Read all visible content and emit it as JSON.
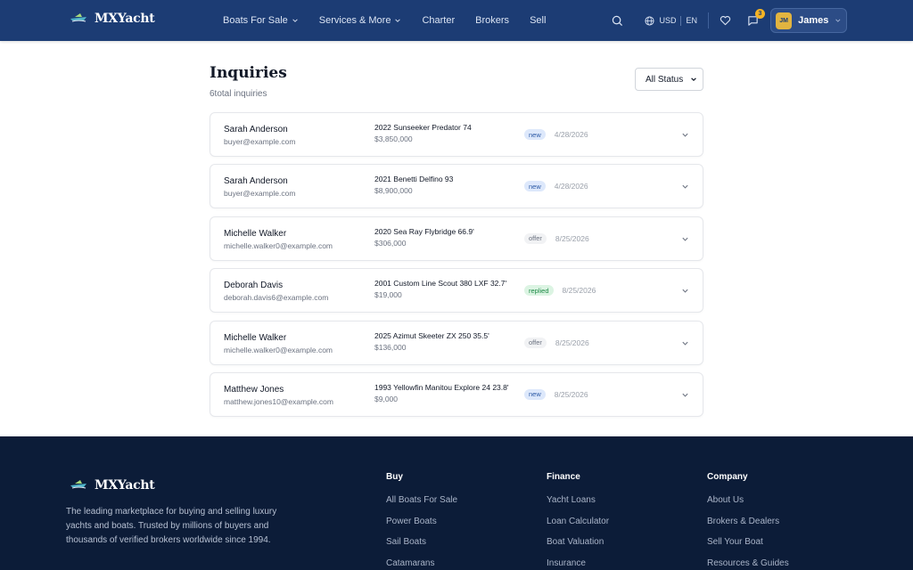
{
  "brand": {
    "name": "MXYacht"
  },
  "nav": {
    "items": [
      {
        "label": "Boats For Sale",
        "dropdown": true
      },
      {
        "label": "Services & More",
        "dropdown": true
      },
      {
        "label": "Charter",
        "dropdown": false
      },
      {
        "label": "Brokers",
        "dropdown": false
      },
      {
        "label": "Sell",
        "dropdown": false
      }
    ]
  },
  "header": {
    "currency": "USD",
    "language": "EN",
    "message_count": "3",
    "user": {
      "initials": "JM",
      "name": "James"
    }
  },
  "page": {
    "title": "Inquiries",
    "subtitle": "6total inquiries",
    "status_filter": "All Status"
  },
  "inquiries": [
    {
      "name": "Sarah Anderson",
      "email": "buyer@example.com",
      "boat": "2022 Sunseeker Predator 74",
      "price": "$3,850,000",
      "status": "new",
      "date": "4/28/2026"
    },
    {
      "name": "Sarah Anderson",
      "email": "buyer@example.com",
      "boat": "2021 Benetti Delfino 93",
      "price": "$8,900,000",
      "status": "new",
      "date": "4/28/2026"
    },
    {
      "name": "Michelle Walker",
      "email": "michelle.walker0@example.com",
      "boat": "2020 Sea Ray Flybridge 66.9'",
      "price": "$306,000",
      "status": "offer",
      "date": "8/25/2026"
    },
    {
      "name": "Deborah Davis",
      "email": "deborah.davis6@example.com",
      "boat": "2001 Custom Line Scout 380 LXF 32.7'",
      "price": "$19,000",
      "status": "replied",
      "date": "8/25/2026"
    },
    {
      "name": "Michelle Walker",
      "email": "michelle.walker0@example.com",
      "boat": "2025 Azimut Skeeter ZX 250 35.5'",
      "price": "$136,000",
      "status": "offer",
      "date": "8/25/2026"
    },
    {
      "name": "Matthew Jones",
      "email": "matthew.jones10@example.com",
      "boat": "1993 Yellowfin Manitou Explore 24 23.8'",
      "price": "$9,000",
      "status": "new",
      "date": "8/25/2026"
    }
  ],
  "footer": {
    "description": "The leading marketplace for buying and selling luxury yachts and boats. Trusted by millions of buyers and thousands of verified brokers worldwide since 1994.",
    "columns": [
      {
        "heading": "Buy",
        "links": [
          "All Boats For Sale",
          "Power Boats",
          "Sail Boats",
          "Catamarans"
        ]
      },
      {
        "heading": "Finance",
        "links": [
          "Yacht Loans",
          "Loan Calculator",
          "Boat Valuation",
          "Insurance"
        ]
      },
      {
        "heading": "Company",
        "links": [
          "About Us",
          "Brokers & Dealers",
          "Sell Your Boat",
          "Resources & Guides"
        ]
      }
    ]
  },
  "colors": {
    "header_bg": "#1c3c74",
    "footer_bg": "#0c1c38",
    "badge_new": "#dde8fb",
    "badge_offer": "#f1f2f4",
    "badge_replied": "#dcf4e3",
    "accent_gold": "#f5b324"
  },
  "icons": {
    "logo": "yacht-logo-icon",
    "search": "search-icon",
    "globe": "globe-icon",
    "favorites": "heart-icon",
    "messages": "message-icon",
    "expand": "chevron-down-icon"
  }
}
